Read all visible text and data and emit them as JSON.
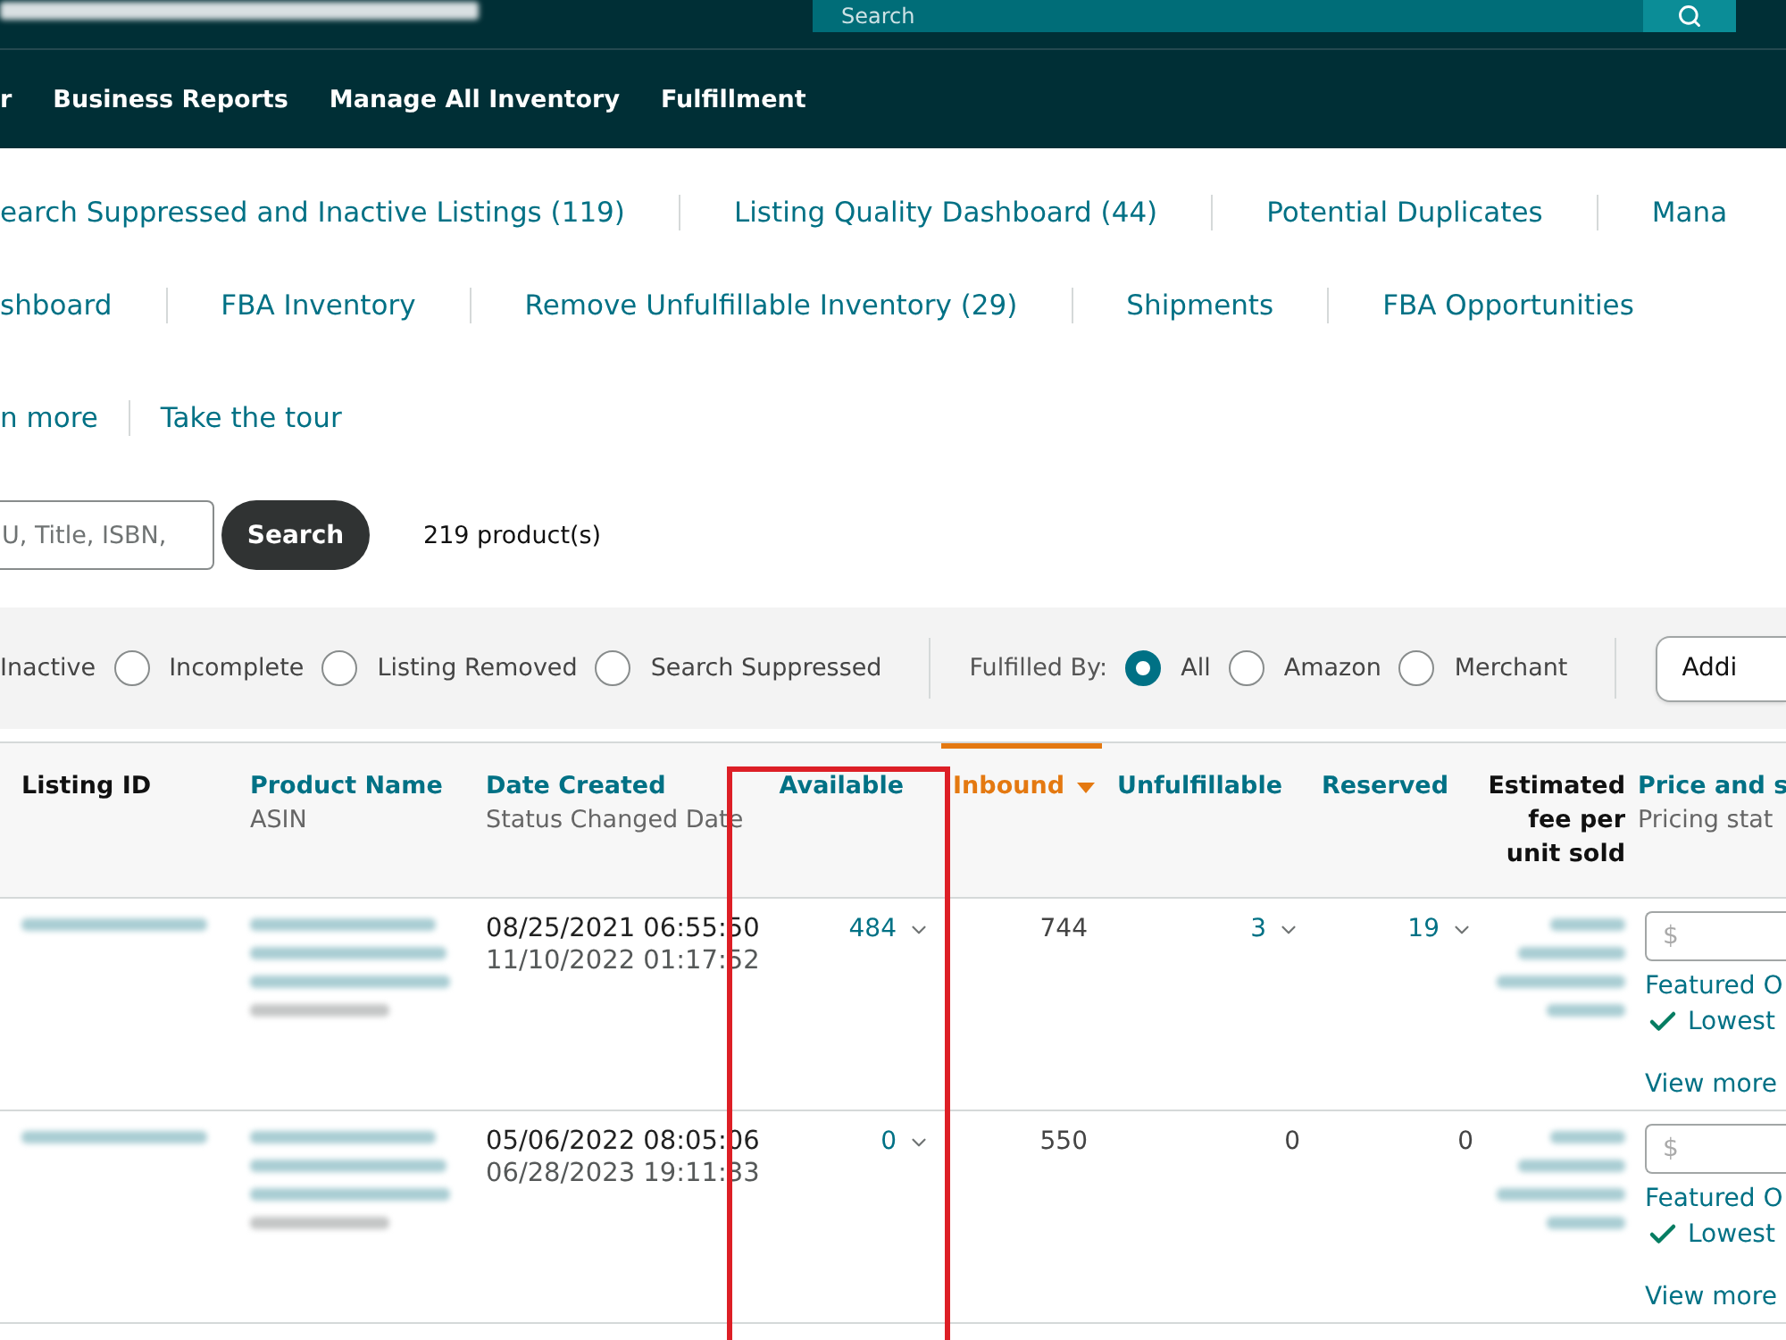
{
  "header": {
    "search_placeholder": "Search",
    "nav": [
      "r",
      "Business Reports",
      "Manage All Inventory",
      "Fulfillment"
    ]
  },
  "link_rows": [
    [
      "earch Suppressed and Inactive Listings (119)",
      "Listing Quality Dashboard (44)",
      "Potential Duplicates",
      "Mana"
    ],
    [
      "shboard",
      "FBA Inventory",
      "Remove Unfulfillable Inventory (29)",
      "Shipments",
      "FBA Opportunities"
    ],
    [
      "n more",
      "Take the tour"
    ]
  ],
  "search": {
    "placeholder": "U, Title, ISBN,",
    "button": "Search",
    "count": "219 product(s)"
  },
  "filters": {
    "status_cut_label": "Inactive",
    "status_options": [
      {
        "label": "Incomplete",
        "selected": false
      },
      {
        "label": "Listing Removed",
        "selected": false
      },
      {
        "label": "Search Suppressed",
        "selected": false
      }
    ],
    "fulfilled_by_label": "Fulfilled By:",
    "fulfilled_by_options": [
      {
        "label": "All",
        "selected": true
      },
      {
        "label": "Amazon",
        "selected": false
      },
      {
        "label": "Merchant",
        "selected": false
      }
    ],
    "button": "Addi"
  },
  "table": {
    "columns": [
      {
        "title": "Listing ID",
        "kind": "plain",
        "sorted": false,
        "highlighted": false
      },
      {
        "title": "Product Name",
        "subtitle": "ASIN",
        "kind": "link",
        "sorted": false,
        "highlighted": false
      },
      {
        "title": "Date Created",
        "subtitle": "Status Changed Date",
        "kind": "link",
        "sorted": false,
        "highlighted": false
      },
      {
        "title": "Available",
        "kind": "link",
        "sorted": false,
        "highlighted": true
      },
      {
        "title": "Inbound",
        "kind": "link",
        "sorted": true,
        "highlighted": false
      },
      {
        "title": "Unfulfillable",
        "kind": "link",
        "sorted": false,
        "highlighted": false
      },
      {
        "title": "Reserved",
        "kind": "link",
        "sorted": false,
        "highlighted": false
      },
      {
        "title": "Estimated fee per unit sold",
        "kind": "plain",
        "sorted": false,
        "highlighted": false
      },
      {
        "title": "Price and s",
        "subtitle": "Pricing stat",
        "kind": "link",
        "sorted": false,
        "highlighted": false
      }
    ],
    "rows": [
      {
        "date_created": "08/25/2021 06:55:50",
        "status_changed": "11/10/2022 01:17:52",
        "quantities": [
          {
            "value": "484",
            "kind": "dropdown"
          },
          {
            "value": "744",
            "kind": "plain"
          },
          {
            "value": "3",
            "kind": "dropdown"
          },
          {
            "value": "19",
            "kind": "dropdown"
          }
        ],
        "price": {
          "placeholder": "$",
          "status": "Featured O",
          "badge": "Lowest",
          "link": "View more"
        }
      },
      {
        "date_created": "05/06/2022 08:05:06",
        "status_changed": "06/28/2023 19:11:33",
        "quantities": [
          {
            "value": "0",
            "kind": "dropdown"
          },
          {
            "value": "550",
            "kind": "plain"
          },
          {
            "value": "0",
            "kind": "plain"
          },
          {
            "value": "0",
            "kind": "plain"
          }
        ],
        "price": {
          "placeholder": "$",
          "status": "Featured O",
          "badge": "Lowest",
          "link": "View more"
        }
      }
    ]
  }
}
